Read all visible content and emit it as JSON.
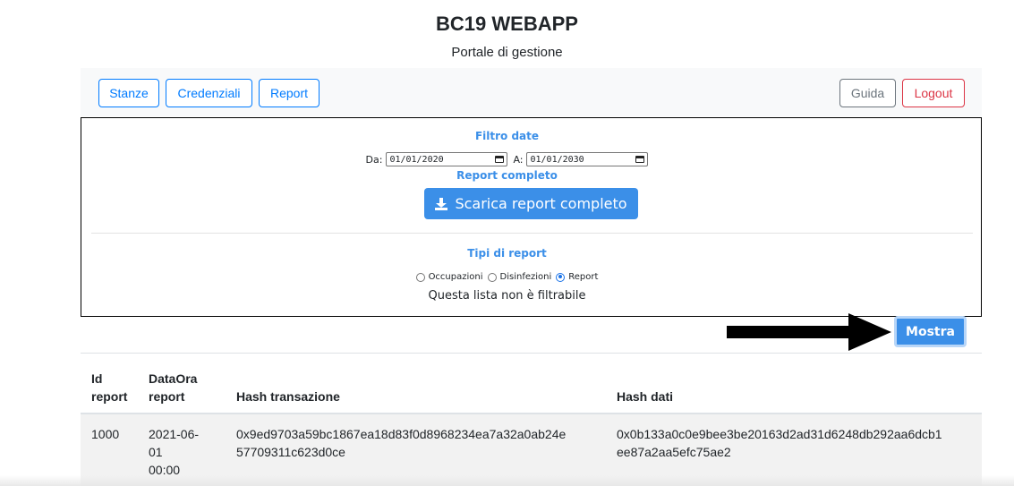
{
  "header": {
    "title": "BC19 WEBAPP",
    "subtitle": "Portale di gestione"
  },
  "nav": {
    "left": [
      "Stanze",
      "Credenziali",
      "Report"
    ],
    "guida": "Guida",
    "logout": "Logout"
  },
  "filter": {
    "title": "Filtro date",
    "from_label": "Da:",
    "from_value": "01/01/2020",
    "to_label": "A:",
    "to_value": "01/01/2030"
  },
  "full_report": {
    "title": "Report completo",
    "button": "Scarica report completo"
  },
  "types": {
    "title": "Tipi di report",
    "options": [
      "Occupazioni",
      "Disinfezioni",
      "Report"
    ],
    "selected": "Report",
    "note": "Questa lista non è filtrabile"
  },
  "show_button": "Mostra",
  "table": {
    "headers": {
      "id": [
        "Id",
        "report"
      ],
      "date": [
        "DataOra",
        "report"
      ],
      "hash_tx": "Hash transazione",
      "hash_data": "Hash dati"
    },
    "rows": [
      {
        "id": "1000",
        "date": [
          "2021-06-",
          "01",
          "00:00"
        ],
        "hash_tx": [
          "0x9ed9703a59bc1867ea18d83f0d8968234ea7a32a0ab24e",
          "57709311c623d0ce"
        ],
        "hash_data": [
          "0x0b133a0c0e9bee3be20163d2ad31d6248db292aa6dcb1",
          "ee87a2aa5efc75ae2"
        ]
      }
    ]
  },
  "colors": {
    "primary": "#3b8fe8",
    "danger": "#dc3545",
    "secondary": "#6c757d"
  }
}
